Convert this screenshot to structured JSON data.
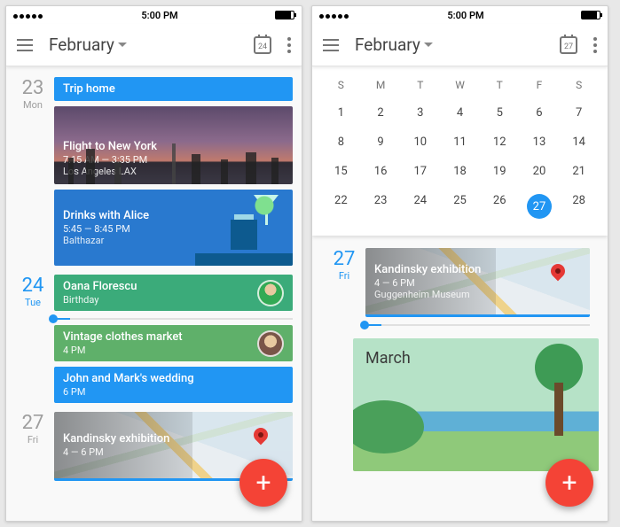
{
  "status": {
    "time": "5:00 PM"
  },
  "left": {
    "month": "February",
    "today_badge": "24",
    "days": [
      {
        "num": "23",
        "dow": "Mon",
        "events": [
          {
            "title": "Trip home"
          },
          {
            "title": "Flight to New York",
            "time": "7:15 AM — 3:35 PM",
            "loc": "Los Angeles LAX"
          },
          {
            "title": "Drinks with Alice",
            "time": "5:45 — 8:45 PM",
            "loc": "Balthazar"
          }
        ]
      },
      {
        "num": "24",
        "dow": "Tue",
        "events": [
          {
            "title": "Oana Florescu",
            "sub": "Birthday"
          },
          {
            "title": "Vintage clothes market",
            "sub": "4 PM"
          },
          {
            "title": "John and Mark's wedding",
            "sub": "6 PM"
          }
        ]
      },
      {
        "num": "27",
        "dow": "Fri",
        "events": [
          {
            "title": "Kandinsky exhibition",
            "sub": "4 — 6 PM"
          }
        ]
      }
    ]
  },
  "right": {
    "month": "February",
    "today_badge": "27",
    "dow": [
      "S",
      "M",
      "T",
      "W",
      "T",
      "F",
      "S"
    ],
    "weeks": [
      [
        "1",
        "2",
        "3",
        "4",
        "5",
        "6",
        "7"
      ],
      [
        "8",
        "9",
        "10",
        "11",
        "12",
        "13",
        "14"
      ],
      [
        "15",
        "16",
        "17",
        "18",
        "19",
        "20",
        "21"
      ],
      [
        "22",
        "23",
        "24",
        "25",
        "26",
        "27",
        "28"
      ]
    ],
    "selected": "27",
    "day": {
      "num": "27",
      "dow": "Fri",
      "event": {
        "title": "Kandinsky exhibition",
        "time": "4 — 6 PM",
        "loc": "Guggenheim Museum"
      }
    },
    "next_month": "March"
  }
}
